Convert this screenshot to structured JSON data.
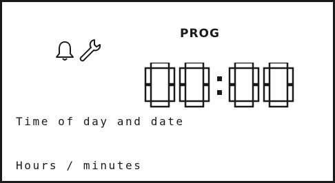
{
  "display": {
    "mode_label": "PROG",
    "time_hours": "00",
    "time_separator": ":",
    "time_minutes": "00",
    "line1": "Time of day and date",
    "line2": "Hours / minutes"
  },
  "icons": [
    "bell-icon",
    "wrench-icon"
  ],
  "colors": {
    "background": "#ffffff",
    "segments": "#1a1a1a"
  }
}
